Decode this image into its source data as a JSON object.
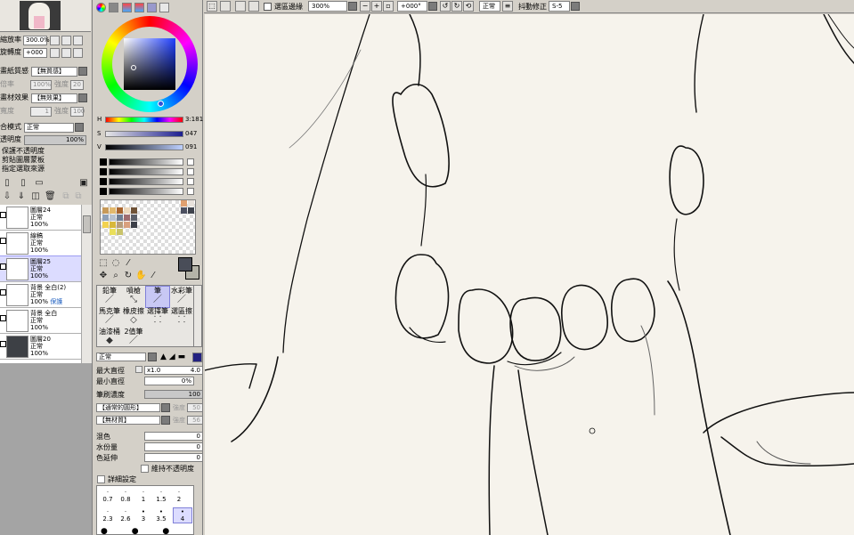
{
  "navigator": {
    "zoom_label": "縮放率",
    "zoom_value": "300.0%",
    "rotate_label": "旋轉度",
    "rotate_value": "+000"
  },
  "layer_props": {
    "paper_texture_label": "畫紙質感",
    "paper_texture_value": "【無質感】",
    "rate_label": "倍率",
    "rate_value": "100%",
    "strength_label": "強度",
    "strength_value": "20",
    "material_effect_label": "畫材效果",
    "material_effect_value": "【無效果】",
    "width_label": "寬度",
    "width_value": "1",
    "strength2_value": "100",
    "blend_label": "合模式",
    "blend_value": "正常",
    "opacity_label": "透明度",
    "opacity_value": "100%",
    "protect_opacity": "保護不透明度",
    "clip_group": "剪貼圖層蒙板",
    "selection_source": "指定選取來源"
  },
  "layers": [
    {
      "name": "圖層24",
      "mode": "正常",
      "opacity": "100%",
      "extra": "",
      "dark": false
    },
    {
      "name": "線稿",
      "mode": "正常",
      "opacity": "100%",
      "extra": "",
      "dark": false
    },
    {
      "name": "圖層25",
      "mode": "正常",
      "opacity": "100%",
      "extra": "",
      "dark": false,
      "selected": true
    },
    {
      "name": "背景 全白(2)",
      "mode": "正常",
      "opacity": "100%",
      "extra": "保護",
      "dark": false
    },
    {
      "name": "背景 全白",
      "mode": "正常",
      "opacity": "100%",
      "extra": "",
      "dark": false
    },
    {
      "name": "圖層20",
      "mode": "正常",
      "opacity": "100%",
      "extra": "",
      "dark": true
    }
  ],
  "color": {
    "h_label": "H",
    "h_value": "3:181",
    "s_label": "S",
    "s_value": "047",
    "v_label": "V",
    "v_value": "091",
    "foreground": "#494d58",
    "background": "#b4b3a8"
  },
  "brushes": {
    "items": [
      {
        "label": "鉛筆",
        "icon": "pencil-icon"
      },
      {
        "label": "噴槍",
        "icon": "airbrush-icon"
      },
      {
        "label": "筆",
        "icon": "pen-icon",
        "selected": true
      },
      {
        "label": "水彩筆",
        "icon": "watercolor-icon"
      },
      {
        "label": "馬克筆",
        "icon": "marker-icon"
      },
      {
        "label": "橡皮擦",
        "icon": "eraser-icon"
      },
      {
        "label": "選擇筆",
        "icon": "select-pen-icon"
      },
      {
        "label": "選區擦",
        "icon": "select-eraser-icon"
      },
      {
        "label": "油漆桶",
        "icon": "bucket-icon"
      },
      {
        "label": "2值筆",
        "icon": "binary-pen-icon"
      }
    ]
  },
  "brush_props": {
    "mode_value": "正常",
    "max_size_label": "最大直徑",
    "max_size_mult": "x1.0",
    "max_size_value": "4.0",
    "min_size_label": "最小直徑",
    "min_size_value": "0%",
    "density_label": "筆刷濃度",
    "density_value": "100",
    "shape_value": "【通常的圓形】",
    "shape_strength_label": "強度",
    "shape_strength_value": "50",
    "texture_value": "【無材質】",
    "texture_strength_label": "強度",
    "texture_strength_value": "56",
    "blend_label": "混色",
    "blend_value": "0",
    "water_label": "水份量",
    "water_value": "0",
    "stretch_label": "色延伸",
    "stretch_value": "0",
    "keep_opacity_label": "維持不透明度",
    "detail_label": "詳細設定"
  },
  "sizes": {
    "row1": [
      "0.7",
      "0.8",
      "1",
      "1.5",
      "2"
    ],
    "row2": [
      "2.3",
      "2.6",
      "3",
      "3.5",
      "4"
    ]
  },
  "topbar": {
    "selection_fill_label": "選區邊緣",
    "zoom_value": "300%",
    "rotate_value": "+000°",
    "mode_value": "正常",
    "stabilizer_label": "抖動修正",
    "stabilizer_value": "S-5"
  }
}
